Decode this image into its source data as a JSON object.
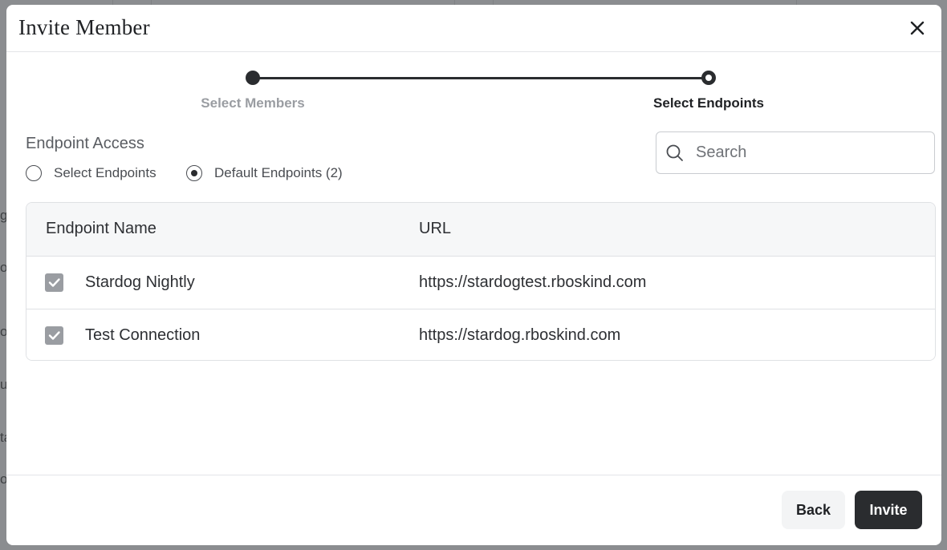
{
  "modal": {
    "title": "Invite Member"
  },
  "stepper": {
    "steps": [
      {
        "label": "Select Members",
        "state": "inactive"
      },
      {
        "label": "Select Endpoints",
        "state": "active"
      }
    ]
  },
  "endpoint_access": {
    "title": "Endpoint Access",
    "options": [
      {
        "label": "Select Endpoints",
        "selected": false
      },
      {
        "label": "Default Endpoints (2)",
        "selected": true
      }
    ]
  },
  "search": {
    "placeholder": "Search",
    "value": ""
  },
  "table": {
    "columns": [
      "Endpoint Name",
      "URL"
    ],
    "rows": [
      {
        "checked": true,
        "name": "Stardog Nightly",
        "url": "https://stardogtest.rboskind.com"
      },
      {
        "checked": true,
        "name": "Test Connection",
        "url": "https://stardog.rboskind.com"
      }
    ]
  },
  "footer": {
    "back_label": "Back",
    "invite_label": "Invite"
  },
  "background_fragments": [
    "g",
    "og",
    "os",
    "u",
    "ta",
    "o"
  ],
  "colors": {
    "primary": "#2a2c2f",
    "checkbox": "#9a9da2",
    "overlay": "#8b8d90"
  },
  "icons": {
    "close": "close-icon",
    "search": "search-icon",
    "check": "check-icon"
  }
}
